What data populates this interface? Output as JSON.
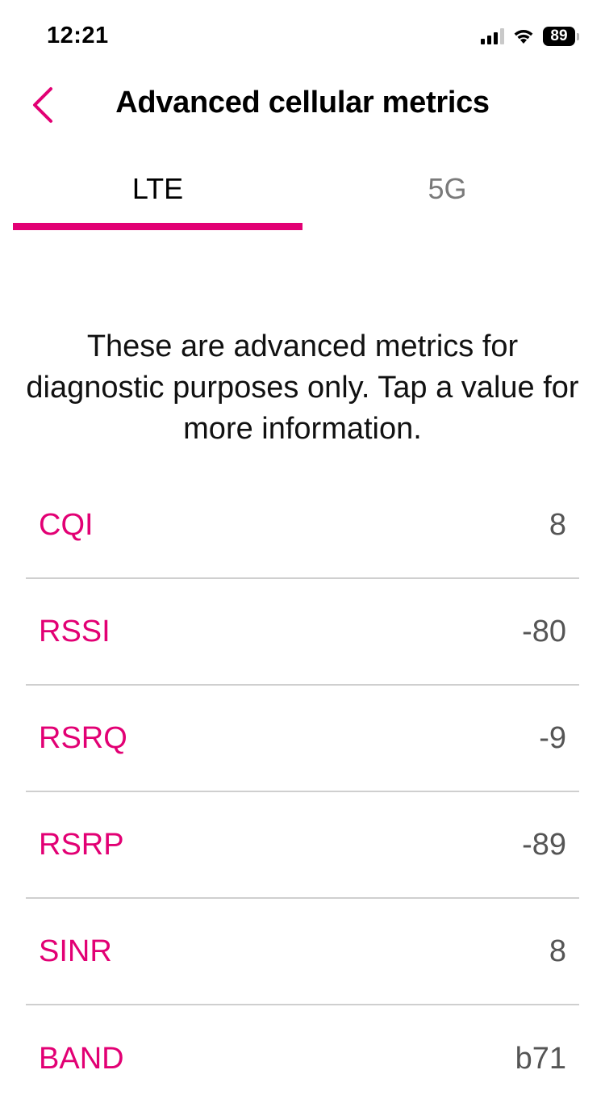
{
  "status_bar": {
    "time": "12:21",
    "battery_level": "89",
    "signal_bars_filled": 3,
    "signal_bars_total": 4
  },
  "header": {
    "title": "Advanced cellular metrics",
    "back_icon": "chevron-left-icon"
  },
  "tabs": [
    {
      "label": "LTE",
      "active": true
    },
    {
      "label": "5G",
      "active": false
    }
  ],
  "description": "These are advanced metrics for diagnostic purposes only. Tap a value for more information.",
  "metrics": [
    {
      "label": "CQI",
      "value": "8"
    },
    {
      "label": "RSSI",
      "value": "-80"
    },
    {
      "label": "RSRQ",
      "value": "-9"
    },
    {
      "label": "RSRP",
      "value": "-89"
    },
    {
      "label": "SINR",
      "value": "8"
    },
    {
      "label": "BAND",
      "value": "b71"
    }
  ],
  "colors": {
    "accent": "#e20074",
    "value_text": "#555555",
    "divider": "#cfcfcf"
  }
}
